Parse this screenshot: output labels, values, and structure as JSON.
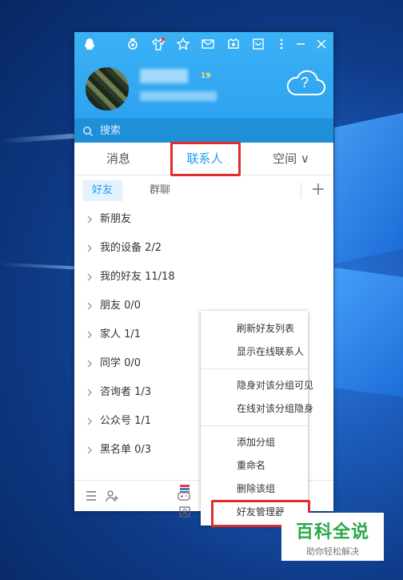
{
  "window": {
    "title_icons": [
      "qq-penguin-icon",
      "medal-icon",
      "tshirt-icon",
      "star-icon",
      "mail-icon",
      "shield-icon",
      "calendar-icon",
      "more-icon",
      "minimize-icon",
      "close-icon"
    ],
    "level_badge": "19",
    "search": {
      "placeholder": "搜索"
    },
    "weather_glyph": "?"
  },
  "tabs": [
    {
      "label": "消息"
    },
    {
      "label": "联系人",
      "active": true
    },
    {
      "label": "空间 ∨"
    }
  ],
  "subtabs": [
    {
      "label": "好友",
      "active": true
    },
    {
      "label": "群聊"
    }
  ],
  "add_symbol": "+",
  "groups": [
    {
      "label": "新朋友"
    },
    {
      "label": "我的设备 2/2"
    },
    {
      "label": "我的好友 11/18"
    },
    {
      "label": "朋友 0/0"
    },
    {
      "label": "家人 1/1"
    },
    {
      "label": "同学 0/0"
    },
    {
      "label": "咨询者 1/3"
    },
    {
      "label": "公众号 1/1"
    },
    {
      "label": "黑名单 0/3"
    }
  ],
  "context_menu": {
    "items": [
      {
        "label": "刷新好友列表"
      },
      {
        "label": "显示在线联系人"
      },
      {
        "label": "隐身对该分组可见"
      },
      {
        "label": "在线对该分组隐身"
      },
      {
        "label": "添加分组"
      },
      {
        "label": "重命名"
      },
      {
        "label": "删除该组"
      },
      {
        "label": "好友管理器"
      }
    ]
  },
  "watermark": {
    "title": "百科全说",
    "subtitle": "助你轻松解决"
  },
  "colors": {
    "accent": "#1a9ff2",
    "header": "#2a9fef",
    "highlight": "#e02e2e",
    "watermark": "#2aa84a"
  }
}
